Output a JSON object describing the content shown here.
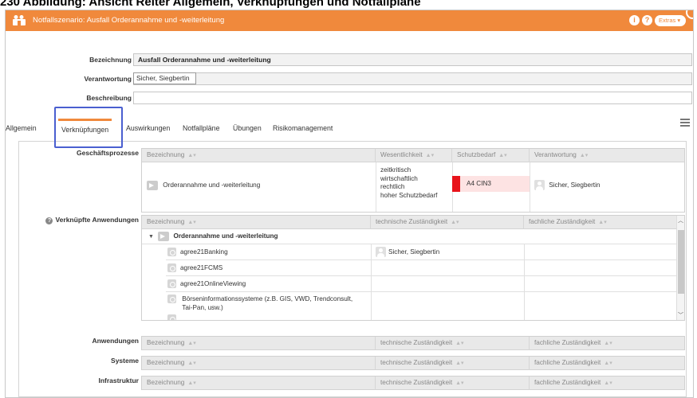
{
  "caption": "230 Abbildung: Ansicht Reiter Allgemein, Verknüpfungen und Notfallpläne",
  "window": {
    "title": "Notfallszenario: Ausfall Orderannahme und -weiterleitung",
    "info_label": "i",
    "help_label": "?",
    "extras_label": "Extras ▾",
    "accent_color": "#f0893c"
  },
  "form": {
    "bezeichnung_label": "Bezeichnung",
    "bezeichnung_value": "Ausfall Orderannahme und -weiterleitung",
    "verantwortung_label": "Verantwortung",
    "verantwortung_value": "Sicher, Siegbertin",
    "beschreibung_label": "Beschreibung",
    "beschreibung_value": ""
  },
  "tabs": [
    "Allgemein",
    "Verknüpfungen",
    "Auswirkungen",
    "Notfallpläne",
    "Übungen",
    "Risikomanagement"
  ],
  "active_tab": "Verknüpfungen",
  "geschaeftsprozesse": {
    "label": "Geschäftsprozesse",
    "columns": [
      "Bezeichnung",
      "Wesentlichkeit",
      "Schutzbedarf",
      "Verantwortung"
    ],
    "rows": [
      {
        "bezeichnung": "Orderannahme und -weiterleitung",
        "wesentlichkeit": [
          "zeitkritisch",
          "wirtschaftlich",
          "rechtlich",
          "hoher Schutzbedarf"
        ],
        "schutzbedarf": "A4 CIN3",
        "schutzbedarf_color": "#e8131b",
        "verantwortung": "Sicher, Siegbertin"
      }
    ]
  },
  "verknuepfte_anwendungen": {
    "label": "Verknüpfte Anwendungen",
    "help_icon": "?",
    "columns": [
      "Bezeichnung",
      "technische Zuständigkeit",
      "fachliche Zuständigkeit"
    ],
    "group": "Orderannahme und -weiterleitung",
    "rows": [
      {
        "name": "agree21Banking",
        "technisch": "Sicher, Siegbertin",
        "fachlich": ""
      },
      {
        "name": "agree21FCMS",
        "technisch": "",
        "fachlich": ""
      },
      {
        "name": "agree21OnlineViewing",
        "technisch": "",
        "fachlich": ""
      },
      {
        "name": "Börseninformationssysteme (z.B. GIS, VWD, Trendconsult, Tai-Pan, usw.)",
        "name_line1": "Börseninformationssysteme (z.B. GIS, VWD, Trendconsult,",
        "name_line2": "Tai-Pan, usw.)",
        "technisch": "",
        "fachlich": ""
      }
    ]
  },
  "anwendungen": {
    "label": "Anwendungen",
    "columns": [
      "Bezeichnung",
      "technische Zuständigkeit",
      "fachliche Zuständigkeit"
    ]
  },
  "systeme": {
    "label": "Systeme",
    "columns": [
      "Bezeichnung",
      "technische Zuständigkeit",
      "fachliche Zuständigkeit"
    ]
  },
  "infrastruktur": {
    "label": "Infrastruktur",
    "columns": [
      "Bezeichnung",
      "technische Zuständigkeit",
      "fachliche Zuständigkeit"
    ]
  }
}
